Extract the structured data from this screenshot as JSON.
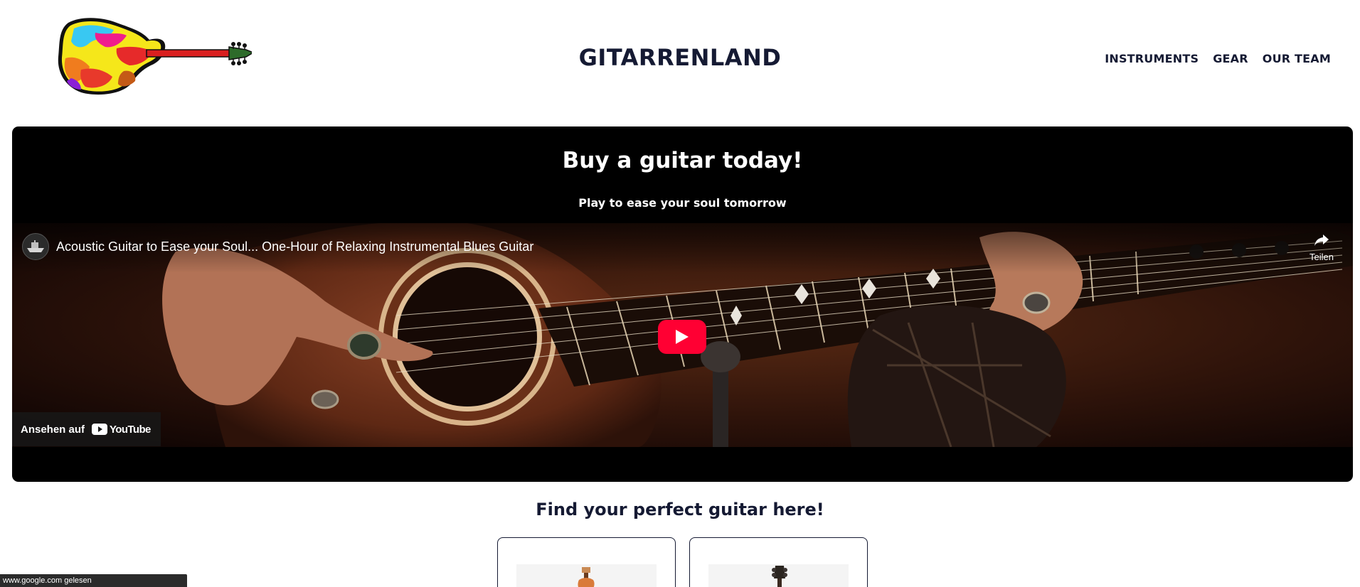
{
  "header": {
    "site_title": "GITARRENLAND",
    "nav": [
      "INSTRUMENTS",
      "GEAR",
      "OUR TEAM"
    ],
    "logo_icon": "guitar-logo-icon"
  },
  "hero": {
    "title": "Buy a guitar today!",
    "subtitle": "Play to ease your soul tomorrow",
    "video": {
      "title": "Acoustic Guitar to Ease your Soul... One-Hour of Relaxing Instrumental Blues Guitar",
      "share_label": "Teilen",
      "watch_on_label": "Ansehen auf",
      "brand": "YouTube",
      "play_color": "#ff0033"
    }
  },
  "find": {
    "title": "Find your perfect guitar here!"
  },
  "status_bar": {
    "text": "www.google.com gelesen"
  },
  "colors": {
    "text": "#151a33",
    "hero_bg": "#000000"
  }
}
